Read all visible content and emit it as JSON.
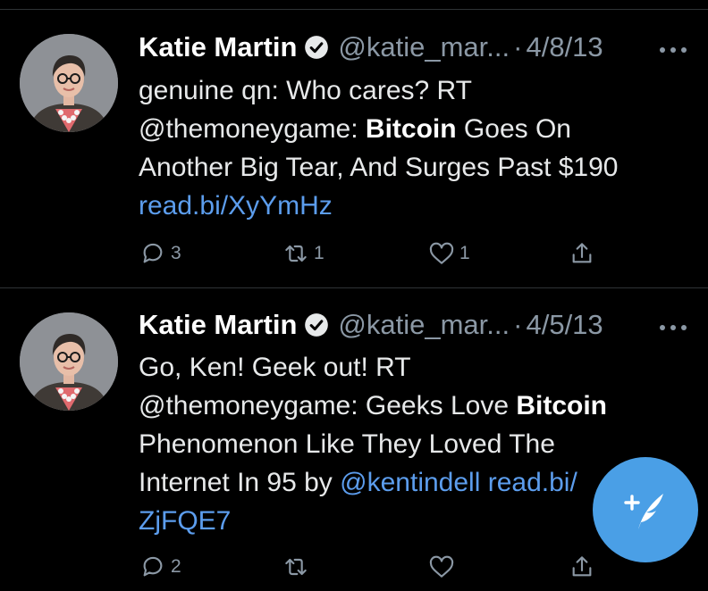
{
  "tweets": [
    {
      "author": "Katie Martin",
      "handle": "@katie_mar...",
      "separator": "·",
      "date": "4/8/13",
      "text_lines": [
        [
          {
            "t": "genuine qn: Who cares? RT"
          }
        ],
        [
          {
            "t": "@themoneygame: "
          },
          {
            "t": "Bitcoin",
            "bold": true
          },
          {
            "t": " Goes On"
          }
        ],
        [
          {
            "t": "Another Big Tear, And Surges Past $190"
          }
        ],
        [
          {
            "t": "read.bi/XyYmHz",
            "link": true
          }
        ]
      ],
      "reply_count": "3",
      "retweet_count": "1",
      "like_count": "1"
    },
    {
      "author": "Katie Martin",
      "handle": "@katie_mar...",
      "separator": "·",
      "date": "4/5/13",
      "text_lines": [
        [
          {
            "t": "Go, Ken! Geek out! RT"
          }
        ],
        [
          {
            "t": "@themoneygame: Geeks Love "
          },
          {
            "t": "Bitcoin",
            "bold": true
          }
        ],
        [
          {
            "t": "Phenomenon Like They Loved The"
          }
        ],
        [
          {
            "t": "Internet In 95 by "
          },
          {
            "t": "@kentindell",
            "link": true
          },
          {
            "t": " read.bi/",
            "link": true
          }
        ],
        [
          {
            "t": "ZjFQE7",
            "link": true
          }
        ]
      ],
      "reply_count": "2",
      "retweet_count": "",
      "like_count": ""
    }
  ],
  "icons": {
    "verified": "verified-badge-icon",
    "more": "more-dots-icon",
    "reply": "reply-icon",
    "retweet": "retweet-icon",
    "like": "heart-icon",
    "share": "share-icon",
    "compose": "compose-icon"
  },
  "colors": {
    "background": "#000000",
    "link": "#5c9ded",
    "muted": "#8b98a5",
    "fab": "#4a9fe6"
  }
}
